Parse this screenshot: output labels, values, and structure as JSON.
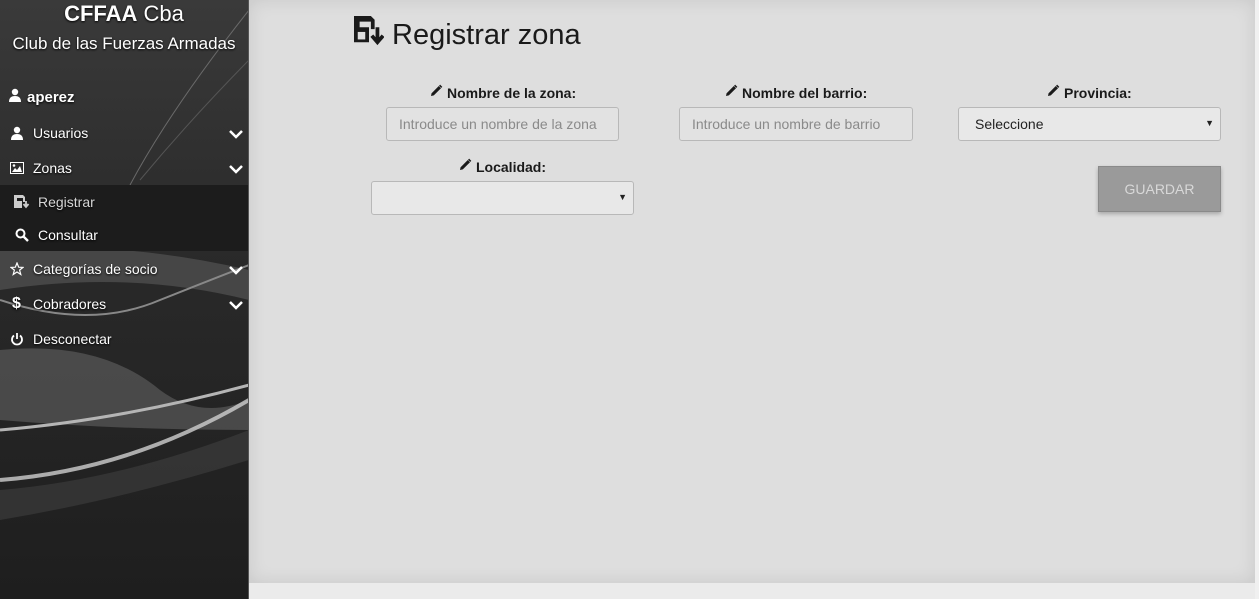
{
  "brand": {
    "title_bold": "CFFAA",
    "title_rest": "Cba",
    "subtitle": "Club de las Fuerzas Armadas"
  },
  "user": {
    "name": "aperez",
    "icon": "user-icon"
  },
  "menu": {
    "usuarios": "Usuarios",
    "zonas": "Zonas",
    "zonas_sub": {
      "registrar": "Registrar",
      "consultar": "Consultar"
    },
    "categorias": "Categorías de socio",
    "cobradores": "Cobradores",
    "desconectar": "Desconectar"
  },
  "page": {
    "title": "Registrar zona",
    "icon": "save-download-icon"
  },
  "form": {
    "nombre_zona": {
      "label": "Nombre de la zona:",
      "placeholder": "Introduce un nombre de la zona",
      "value": ""
    },
    "nombre_barrio": {
      "label": "Nombre del barrio:",
      "placeholder": "Introduce un nombre de barrio",
      "value": ""
    },
    "provincia": {
      "label": "Provincia:",
      "selected": "Seleccione"
    },
    "localidad": {
      "label": "Localidad:",
      "selected": ""
    },
    "save_label": "GUARDAR"
  },
  "colors": {
    "sidebar_bg": "#2a2a2a",
    "main_bg": "#dedede",
    "button_bg": "#9a9a9a"
  }
}
